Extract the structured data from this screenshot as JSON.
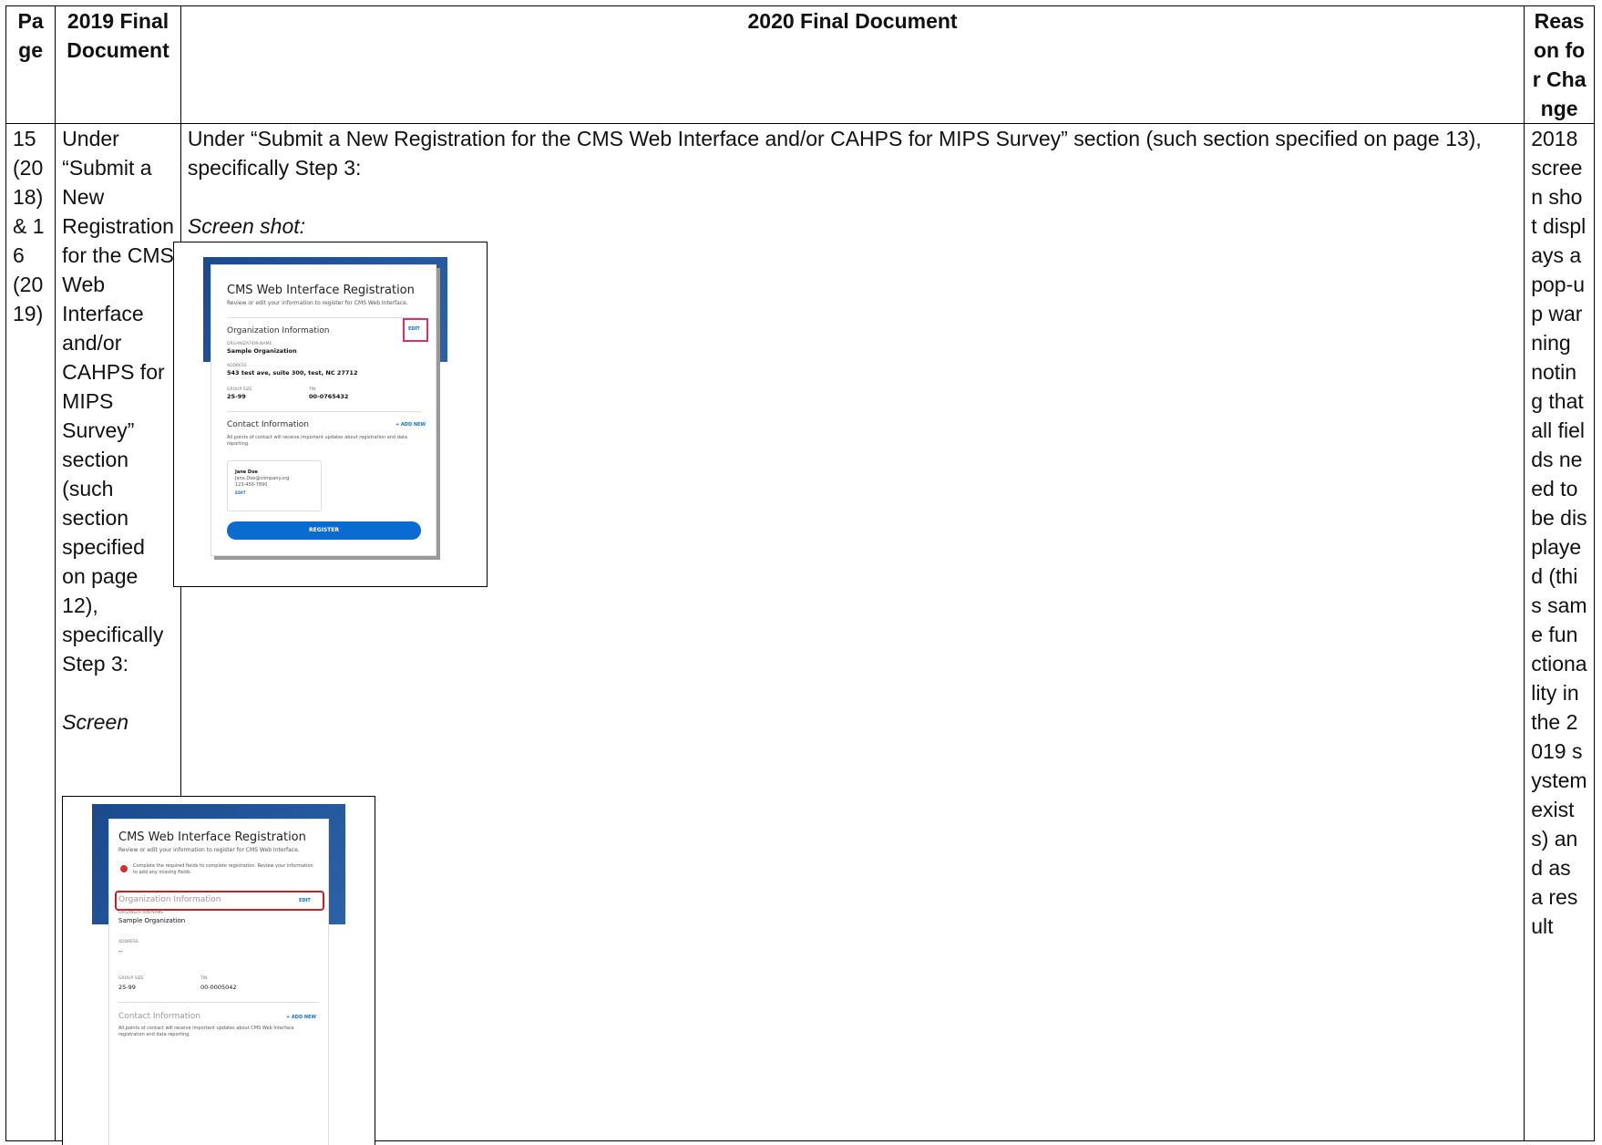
{
  "headers": {
    "page": "Page",
    "final2019": "2019 Final Document",
    "final2020": "2020 Final Document",
    "reason": "Reason for Change"
  },
  "page_cell": "15 (2018) & 16 (2019)",
  "col2019": {
    "text": "Under “Submit a New Registration for the CMS Web Interface and/or CAHPS for MIPS Survey” section (such section specified on page 12), specifically Step 3:",
    "screen_label": "Screen"
  },
  "col2020": {
    "intro": "Under “Submit a New Registration for the CMS Web Interface and/or CAHPS for MIPS Survey” section (such section specified on page 13), specifically Step 3:",
    "screen_label": "Screen shot:"
  },
  "reason_text": "2018 screen shot displays a pop-up warning noting that all fields need to be displayed (this same functionality in the 2019 system exists) and as a result",
  "shot2020": {
    "title": "CMS Web Interface Registration",
    "subtitle": "Review or edit your information to register for CMS Web Interface.",
    "org_heading": "Organization Information",
    "edit": "EDIT",
    "org_name_label": "ORGANIZATION NAME",
    "org_name": "Sample Organization",
    "address_label": "ADDRESS",
    "address": "543 test ave, suite 300, test, NC 27712",
    "group_size_label": "GROUP SIZE",
    "group_size": "25-99",
    "tin_label": "TIN",
    "tin": "00-0765432",
    "contact_heading": "Contact Information",
    "add_new": "+ ADD NEW",
    "contact_note": "All points of contact will receive important updates about registration and data reporting.",
    "contact_name": "Jane Doe",
    "contact_email": "Jane.Doe@company.org",
    "contact_phone": "123-456-7890",
    "contact_edit": "EDIT",
    "register": "REGISTER"
  },
  "shot2019": {
    "title": "CMS Web Interface Registration",
    "subtitle": "Review or edit your information to register for CMS Web Interface.",
    "warning": "Complete the required fields to complete registration. Review your information to add any missing fields.",
    "org_heading": "Organization Information",
    "edit": "EDIT",
    "org_name_label": "ORGANIZATION NAME",
    "org_name": "Sample Organization",
    "address_label": "ADDRESS",
    "address": "--",
    "group_size_label": "GROUP SIZE",
    "group_size": "25-99",
    "tin_label": "TIN",
    "tin": "00-0005042",
    "contact_heading": "Contact Information",
    "add_new": "+ ADD NEW",
    "contact_note": "All points of contact will receive important updates about CMS Web Interface registration and data reporting."
  }
}
